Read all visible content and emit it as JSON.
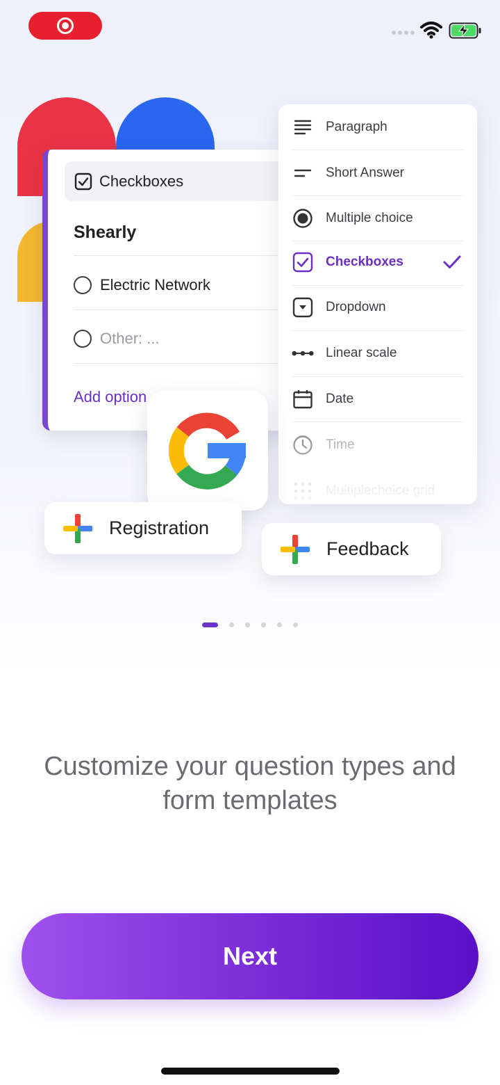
{
  "colors": {
    "accent": "#6b2fc4",
    "record_red": "#e8202e",
    "shape_red": "#ea3345",
    "shape_blue": "#2b66ef",
    "shape_yellow": "#f4b72e",
    "button_start": "#a050ec",
    "button_end": "#5a10c8"
  },
  "status_bar": {
    "record_icon": "screen-record-icon",
    "signal_icon": "cellular-signal-icon",
    "wifi_icon": "wifi-icon",
    "battery_icon": "battery-charging-icon"
  },
  "form_card": {
    "question_type": "Checkboxes",
    "question_title": "Shearly",
    "options": [
      {
        "label": "Electric Network",
        "muted": false
      },
      {
        "label": "Other: ...",
        "muted": true
      }
    ],
    "add_option": "Add option"
  },
  "type_menu": {
    "items": [
      {
        "label": "Paragraph",
        "icon": "paragraph-icon"
      },
      {
        "label": "Short Answer",
        "icon": "short-answer-icon"
      },
      {
        "label": "Multiple choice",
        "icon": "radio-button-icon"
      },
      {
        "label": "Checkboxes",
        "icon": "checkbox-icon",
        "selected": true
      },
      {
        "label": "Dropdown",
        "icon": "dropdown-icon"
      },
      {
        "label": "Linear scale",
        "icon": "linear-scale-icon"
      },
      {
        "label": "Date",
        "icon": "calendar-icon"
      },
      {
        "label": "Time",
        "icon": "clock-icon"
      },
      {
        "label": "Multiplechoice grid",
        "icon": "grid-icon"
      }
    ]
  },
  "chips": {
    "registration": "Registration",
    "feedback": "Feedback"
  },
  "pager": {
    "total": 6,
    "current": 1
  },
  "headline": "Customize your question types and form templates",
  "next_button": "Next"
}
